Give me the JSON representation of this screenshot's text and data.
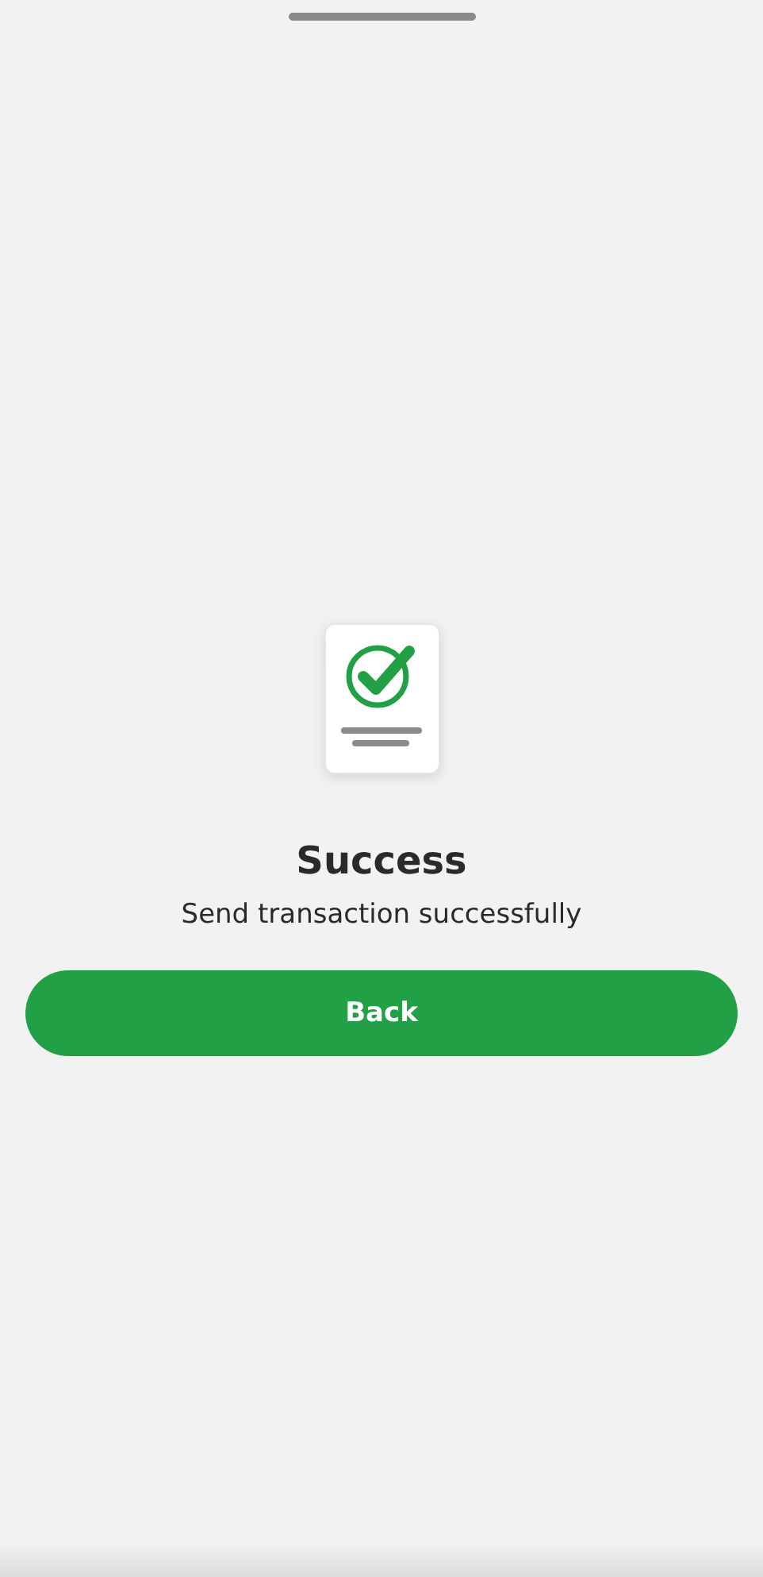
{
  "title": "Success",
  "message": "Send transaction successfully",
  "button": "Back"
}
